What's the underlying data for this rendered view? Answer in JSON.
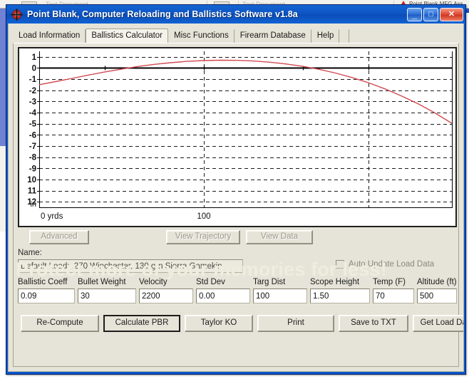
{
  "desktop": {
    "bg_cells": [
      "Text Document",
      "Text Document"
    ],
    "bg_right_title": "Point Blank MFG Ass"
  },
  "window": {
    "title": "Point Blank, Computer Reloading and Ballistics Software v1.8a",
    "icon": "crosshair-icon",
    "caption": {
      "minimize": "_",
      "maximize": "□",
      "close": "✕"
    }
  },
  "tabs": [
    {
      "label": "Load Information",
      "active": false
    },
    {
      "label": "Ballistics Calculator",
      "active": true
    },
    {
      "label": "Misc Functions",
      "active": false
    },
    {
      "label": "Firearm Database",
      "active": false
    },
    {
      "label": "Help",
      "active": false
    }
  ],
  "chart_data": {
    "type": "line",
    "title": "",
    "xlabel": "yrds",
    "ylabel": "in",
    "x_tick_labels": [
      "0 yrds",
      "100"
    ],
    "x_tick_values": [
      0,
      100
    ],
    "xlim": [
      0,
      252
    ],
    "ylim": [
      -12.5,
      1.5
    ],
    "y_tick_labels": [
      "1",
      "0",
      "-1",
      "-2",
      "-3",
      "-4",
      "-5",
      "-6",
      "-7",
      "-8",
      "-9",
      "10",
      "11",
      "12"
    ],
    "y_tick_values": [
      1,
      0,
      -1,
      -2,
      -3,
      -4,
      -5,
      -6,
      -7,
      -8,
      -9,
      -10,
      -11,
      -12
    ],
    "y_axis_unit": "in",
    "grid": true,
    "legend": "none",
    "series": [
      {
        "name": "Trajectory",
        "color": "#d14b52",
        "x": [
          0,
          10,
          20,
          30,
          40,
          50,
          60,
          70,
          80,
          90,
          100,
          110,
          120,
          130,
          140,
          150,
          160,
          170,
          180,
          190,
          200,
          210,
          220,
          230,
          240,
          250
        ],
        "y": [
          -1.5,
          -1.22,
          -0.93,
          -0.63,
          -0.35,
          -0.1,
          0.14,
          0.33,
          0.48,
          0.6,
          0.67,
          0.7,
          0.69,
          0.63,
          0.52,
          0.36,
          0.15,
          -0.12,
          -0.45,
          -0.85,
          -1.32,
          -1.87,
          -2.5,
          -3.2,
          -4.0,
          -4.9
        ]
      }
    ],
    "zero_line": 0,
    "vertical_gridlines": [
      100,
      200
    ]
  },
  "mid_buttons": [
    {
      "label": "Advanced",
      "disabled": true
    },
    {
      "label": "View Trajectory",
      "disabled": true
    },
    {
      "label": "View Data",
      "disabled": true
    }
  ],
  "name_label": "Name:",
  "load_name": "Default Load: .270 Winchester, 130 grn Sierra Gamekin",
  "auto_update": {
    "label": "Auto Update Load Data",
    "checked": false
  },
  "fields": [
    {
      "label": "Ballistic Coeff",
      "value": "0.09"
    },
    {
      "label": "Bullet Weight",
      "value": "30"
    },
    {
      "label": "Velocity",
      "value": "2200"
    },
    {
      "label": "Std Dev",
      "value": "0.00"
    },
    {
      "label": "Targ Dist",
      "value": "100"
    },
    {
      "label": "Scope Height",
      "value": "1.50"
    },
    {
      "label": "Temp (F)",
      "value": "70"
    },
    {
      "label": "Altitude (ft)",
      "value": "500"
    }
  ],
  "bottom_buttons": [
    {
      "label": "Re-Compute",
      "default": false
    },
    {
      "label": "Calculate PBR",
      "default": true
    },
    {
      "label": "Taylor KO",
      "default": false
    },
    {
      "label": "Print",
      "default": false
    },
    {
      "label": "Save to TXT",
      "default": false
    },
    {
      "label": "Get Load Data",
      "default": false
    }
  ],
  "watermark": "Protect more of your memories for less!",
  "colors": {
    "titlebar": "#0d55c4",
    "window_face": "#e6e4d8",
    "trajectory": "#d14b52",
    "watermark": "#efeddf"
  }
}
